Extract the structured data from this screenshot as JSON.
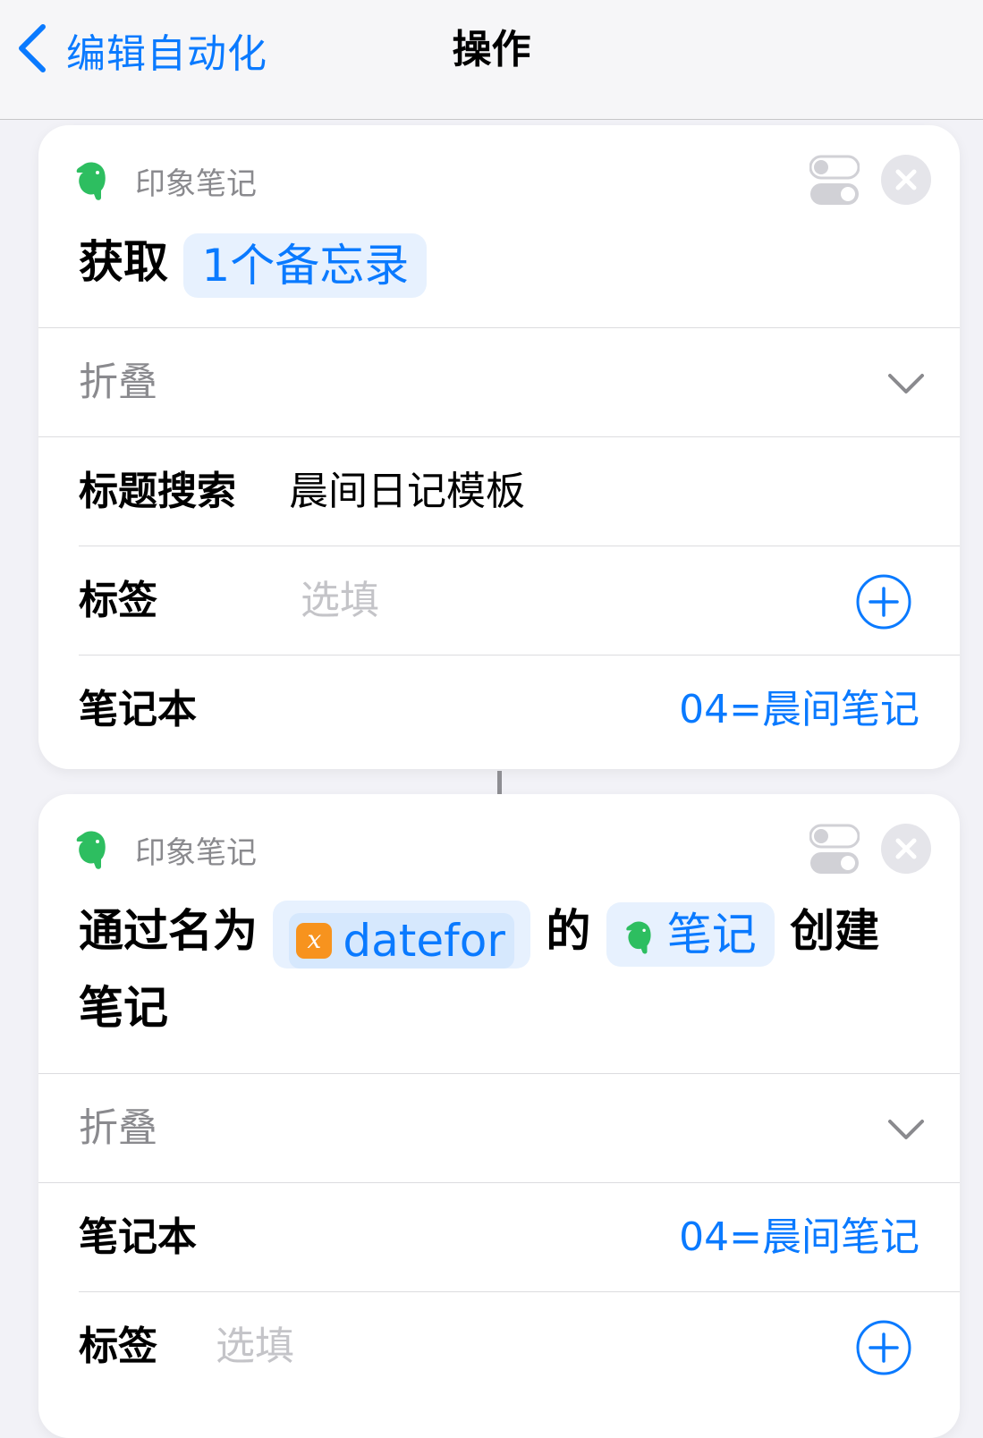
{
  "nav": {
    "back_label": "编辑自动化",
    "title": "操作"
  },
  "colors": {
    "accent": "#0a7aff",
    "evernote_green": "#2dbe60",
    "variable_orange": "#f7931e"
  },
  "action1": {
    "app_name": "印象笔记",
    "app_icon": "evernote-elephant-icon",
    "verb": "获取",
    "token": "1个备忘录",
    "collapse_label": "折叠",
    "title_search_label": "标题搜索",
    "title_search_value": "晨间日记模板",
    "tags_label": "标签",
    "tags_placeholder": "选填",
    "notebook_label": "笔记本",
    "notebook_value": "04=晨间笔记"
  },
  "action2": {
    "app_name": "印象笔记",
    "app_icon": "evernote-elephant-icon",
    "text_before": "通过名为",
    "variable_name": "datefor",
    "variable_icon_glyph": "x",
    "text_middle": "的",
    "note_token": "笔记",
    "text_after": "创建笔记",
    "collapse_label": "折叠",
    "notebook_label": "笔记本",
    "notebook_value": "04=晨间笔记",
    "tags_label": "标签",
    "tags_placeholder": "选填"
  }
}
